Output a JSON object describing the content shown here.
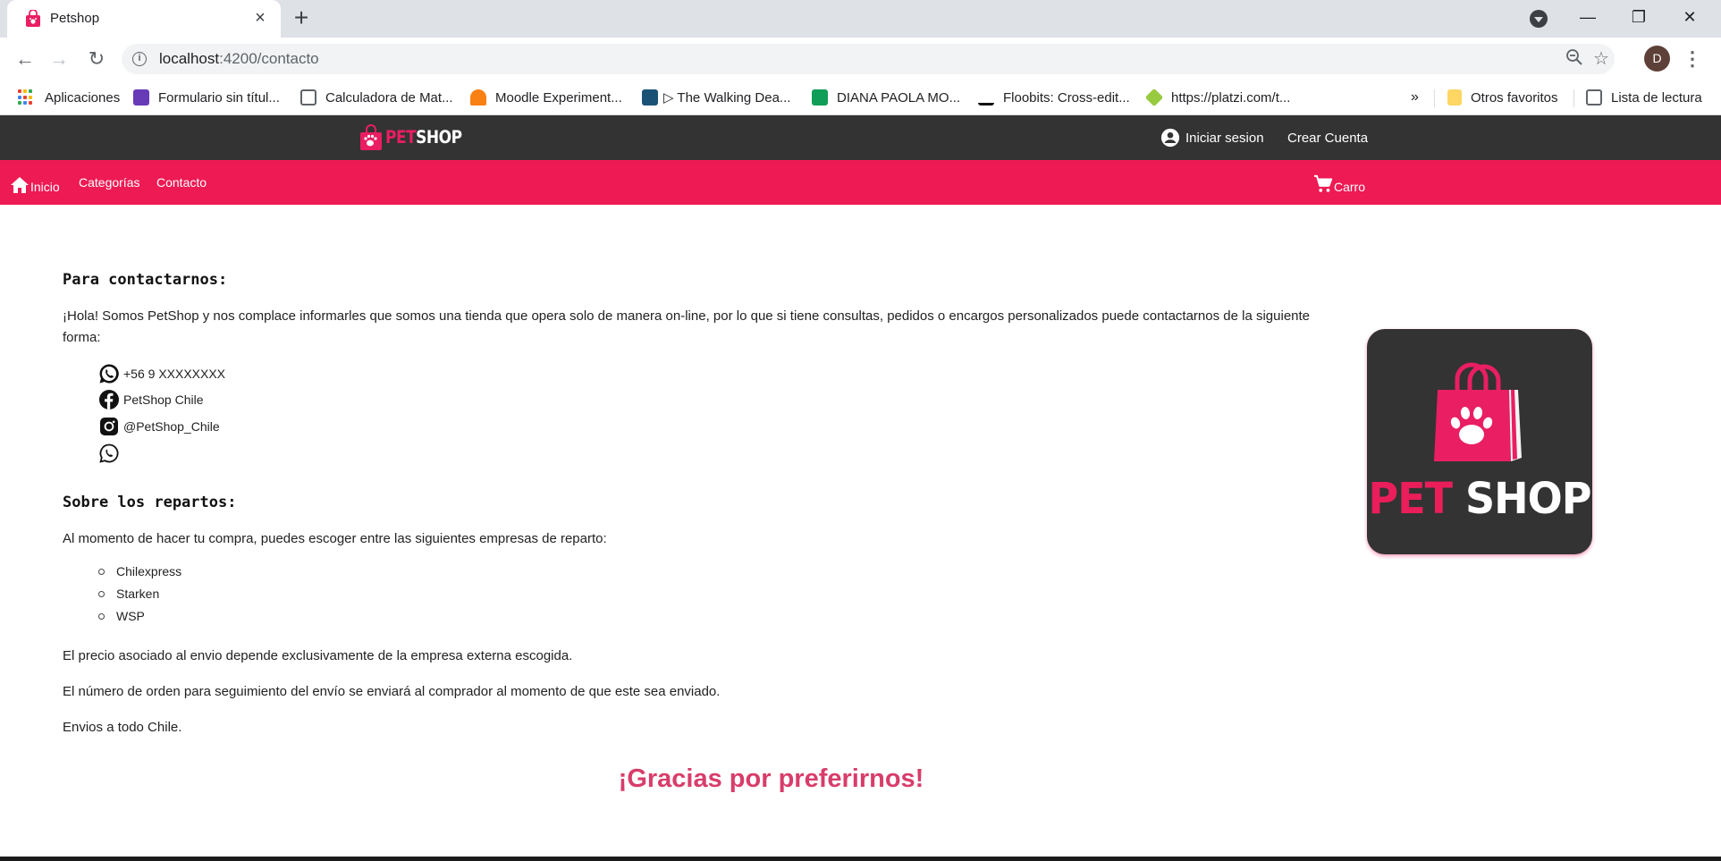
{
  "browser": {
    "tab_title": "Petshop",
    "tab_close": "×",
    "new_tab": "+",
    "url_host": "localhost",
    "url_path": ":4200/contacto",
    "profile_initial": "D",
    "window_controls": {
      "minimize": "—",
      "restore": "❐",
      "close": "✕"
    }
  },
  "bookmarks": [
    {
      "label": "Aplicaciones",
      "icon": "apps-icon"
    },
    {
      "label": "Formulario sin títul...",
      "icon": "forms-icon",
      "color": "#673ab7"
    },
    {
      "label": "Calculadora de Mat...",
      "icon": "calculator-icon",
      "color": "#5f6368"
    },
    {
      "label": "Moodle Experiment...",
      "icon": "moodle-icon",
      "color": "#f98012"
    },
    {
      "label": "▷ The Walking Dea...",
      "icon": "tv-icon",
      "color": "#1a5276"
    },
    {
      "label": "DIANA PAOLA MO...",
      "icon": "sheets-icon",
      "color": "#0f9d58"
    },
    {
      "label": "Floobits: Cross-edit...",
      "icon": "floobits-icon",
      "color": "#111111"
    },
    {
      "label": "https://platzi.com/t...",
      "icon": "platzi-icon",
      "color": "#98ca3f"
    }
  ],
  "bookmarks_overflow": "»",
  "bookmarks_right": [
    {
      "label": "Otros favoritos",
      "icon": "folder-icon",
      "color": "#fdd663"
    },
    {
      "label": "Lista de lectura",
      "icon": "reading-list-icon"
    }
  ],
  "header": {
    "logo_pet": "PET",
    "logo_shop": "SHOP",
    "login": "Iniciar sesion",
    "register": "Crear Cuenta"
  },
  "nav": {
    "home": "Inicio",
    "categories": "Categorías",
    "contact": "Contacto",
    "cart": "Carro"
  },
  "contact": {
    "heading": "Para contactarnos:",
    "intro": "¡Hola! Somos PetShop y nos complace informarles que somos una tienda que opera solo de manera on-line, por lo que si tiene consultas, pedidos o encargos personalizados puede contactarnos de la siguiente forma:",
    "channels": [
      {
        "icon": "whatsapp-icon",
        "text": "+56 9 XXXXXXXX"
      },
      {
        "icon": "facebook-icon",
        "text": "PetShop Chile"
      },
      {
        "icon": "instagram-icon",
        "text": "@PetShop_Chile"
      },
      {
        "icon": "whatsapp-icon",
        "text": ""
      }
    ]
  },
  "delivery": {
    "heading": "Sobre los repartos:",
    "intro": "Al momento de hacer tu compra, puedes escoger entre las siguientes empresas de reparto:",
    "companies": [
      "Chilexpress",
      "Starken",
      "WSP"
    ],
    "price_note": "El precio asociado al envio depende exclusivamente de la empresa externa escogida.",
    "tracking_note": "El número de orden para seguimiento del envío se enviará al comprador al momento de que este sea enviado.",
    "coverage": "Envios a todo Chile."
  },
  "brand_image": {
    "pet": "PET",
    "shop": "SHOP"
  },
  "thanks": "¡Gracias por preferirnos!",
  "colors": {
    "header": "#333333",
    "navbar": "#ee1a54",
    "accent": "#e91e63",
    "thanks": "#d83d6a"
  }
}
